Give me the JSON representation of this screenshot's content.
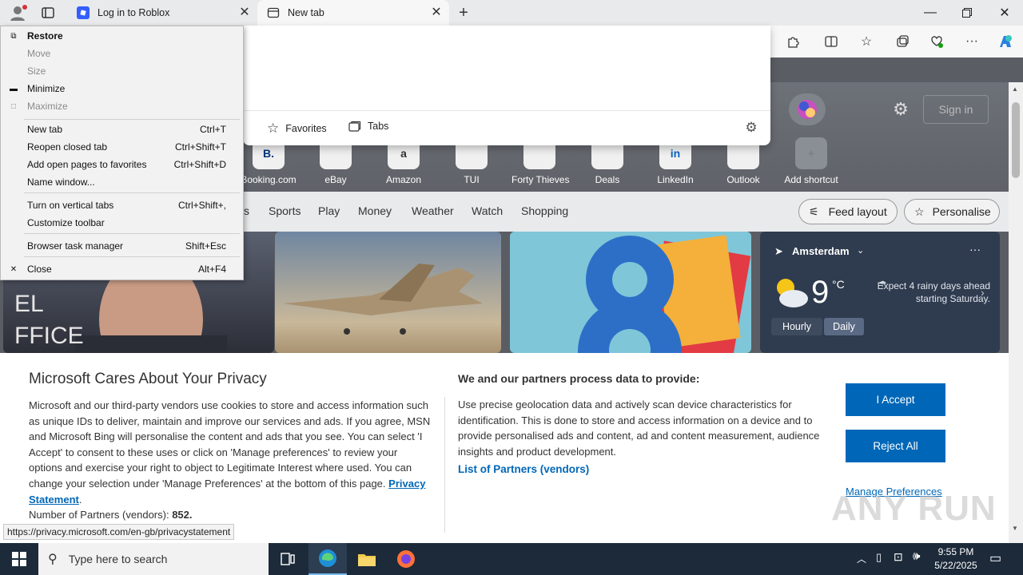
{
  "tabs": [
    {
      "label": "Log in to Roblox"
    },
    {
      "label": "New tab"
    }
  ],
  "system_menu": {
    "items": [
      {
        "label": "Restore",
        "shortcut": "",
        "disabled": false,
        "icon": "restore-icon"
      },
      {
        "label": "Move",
        "shortcut": "",
        "disabled": true,
        "icon": ""
      },
      {
        "label": "Size",
        "shortcut": "",
        "disabled": true,
        "icon": ""
      },
      {
        "label": "Minimize",
        "shortcut": "",
        "disabled": false,
        "icon": "minimize-icon"
      },
      {
        "label": "Maximize",
        "shortcut": "",
        "disabled": true,
        "icon": "maximize-icon"
      },
      {
        "label": "New tab",
        "shortcut": "Ctrl+T",
        "disabled": false
      },
      {
        "label": "Reopen closed tab",
        "shortcut": "Ctrl+Shift+T",
        "disabled": false
      },
      {
        "label": "Add open pages to favorites",
        "shortcut": "Ctrl+Shift+D",
        "disabled": false
      },
      {
        "label": "Name window...",
        "shortcut": "",
        "disabled": false
      },
      {
        "label": "Turn on vertical tabs",
        "shortcut": "Ctrl+Shift+,",
        "disabled": false
      },
      {
        "label": "Customize toolbar",
        "shortcut": "",
        "disabled": false
      },
      {
        "label": "Browser task manager",
        "shortcut": "Shift+Esc",
        "disabled": false
      },
      {
        "label": "Close",
        "shortcut": "Alt+F4",
        "disabled": false,
        "icon": "close-icon"
      }
    ]
  },
  "address_dropdown": {
    "favorites_label": "Favorites",
    "tabs_label": "Tabs"
  },
  "ntp": {
    "signin": "Sign in",
    "shortcuts": [
      {
        "label": "Booking.com",
        "mark": "B."
      },
      {
        "label": "eBay",
        "mark": ""
      },
      {
        "label": "Amazon",
        "mark": "a"
      },
      {
        "label": "TUI",
        "mark": ""
      },
      {
        "label": "Forty Thieves",
        "mark": ""
      },
      {
        "label": "Deals",
        "mark": ""
      },
      {
        "label": "LinkedIn",
        "mark": "in"
      },
      {
        "label": "Outlook",
        "mark": ""
      },
      {
        "label": "Add shortcut",
        "mark": "+"
      }
    ],
    "nav": [
      "s",
      "Sports",
      "Play",
      "Money",
      "Weather",
      "Watch",
      "Shopping"
    ],
    "feed_layout": "Feed layout",
    "personalise": "Personalise",
    "weather": {
      "city": "Amsterdam",
      "temp": "9",
      "unit": "°C",
      "forecast": "Expect 4 rainy days ahead starting Saturday.",
      "tab_hourly": "Hourly",
      "tab_daily": "Daily"
    }
  },
  "privacy": {
    "title": "Microsoft Cares About Your Privacy",
    "body_before_link": "Microsoft and our third-party vendors use cookies to store and access information such as unique IDs to deliver, maintain and improve our services and ads. If you agree, MSN and Microsoft Bing will personalise the content and ads that you see. You can select 'I Accept' to consent to these uses or click on 'Manage preferences' to review your options and exercise your right to object to Legitimate Interest where used.  You can change your selection under 'Manage Preferences' at the bottom of this page.",
    "privacy_link": "Privacy Statement",
    "partners_count_label": "Number of Partners (vendors):",
    "partners_count": "852.",
    "right_title": "We and our partners process data to provide:",
    "right_body": "Use precise geolocation data and actively scan device characteristics for identification. This is done to store and access information on a device and to provide personalised ads and content, ad and content measurement, audience insights and product development.",
    "partners_link": "List of Partners (vendors)",
    "accept": "I Accept",
    "reject": "Reject All",
    "manage": "Manage Preferences"
  },
  "status_url": "https://privacy.microsoft.com/en-gb/privacystatement",
  "taskbar": {
    "search_placeholder": "Type here to search",
    "time": "9:55 PM",
    "date": "5/22/2025"
  },
  "watermark": "ANY RUN"
}
